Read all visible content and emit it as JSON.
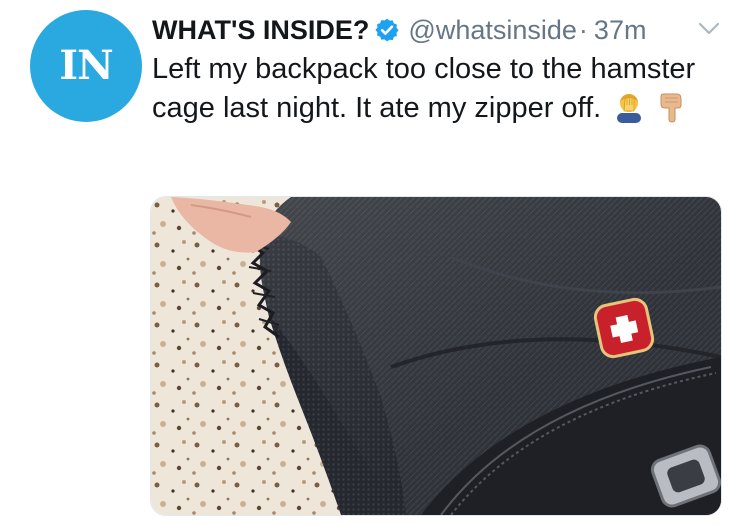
{
  "account": {
    "avatar_text": "IN",
    "display_name": "WHAT'S INSIDE?",
    "handle": "@whatsinside",
    "separator": "·",
    "timestamp": "37m"
  },
  "tweet": {
    "text_main": "Left my backpack too close to the hamster cage last night. It ate my zipper off."
  },
  "icons": {
    "verified": "verified-badge-icon",
    "caret": "chevron-down-icon",
    "emojis": [
      "facepalm-emoji-icon",
      "pointing-down-emoji-icon"
    ]
  },
  "colors": {
    "brand_blue": "#2aa9e0",
    "verified_blue": "#1da1f2",
    "muted": "#657786",
    "text": "#14171a"
  }
}
